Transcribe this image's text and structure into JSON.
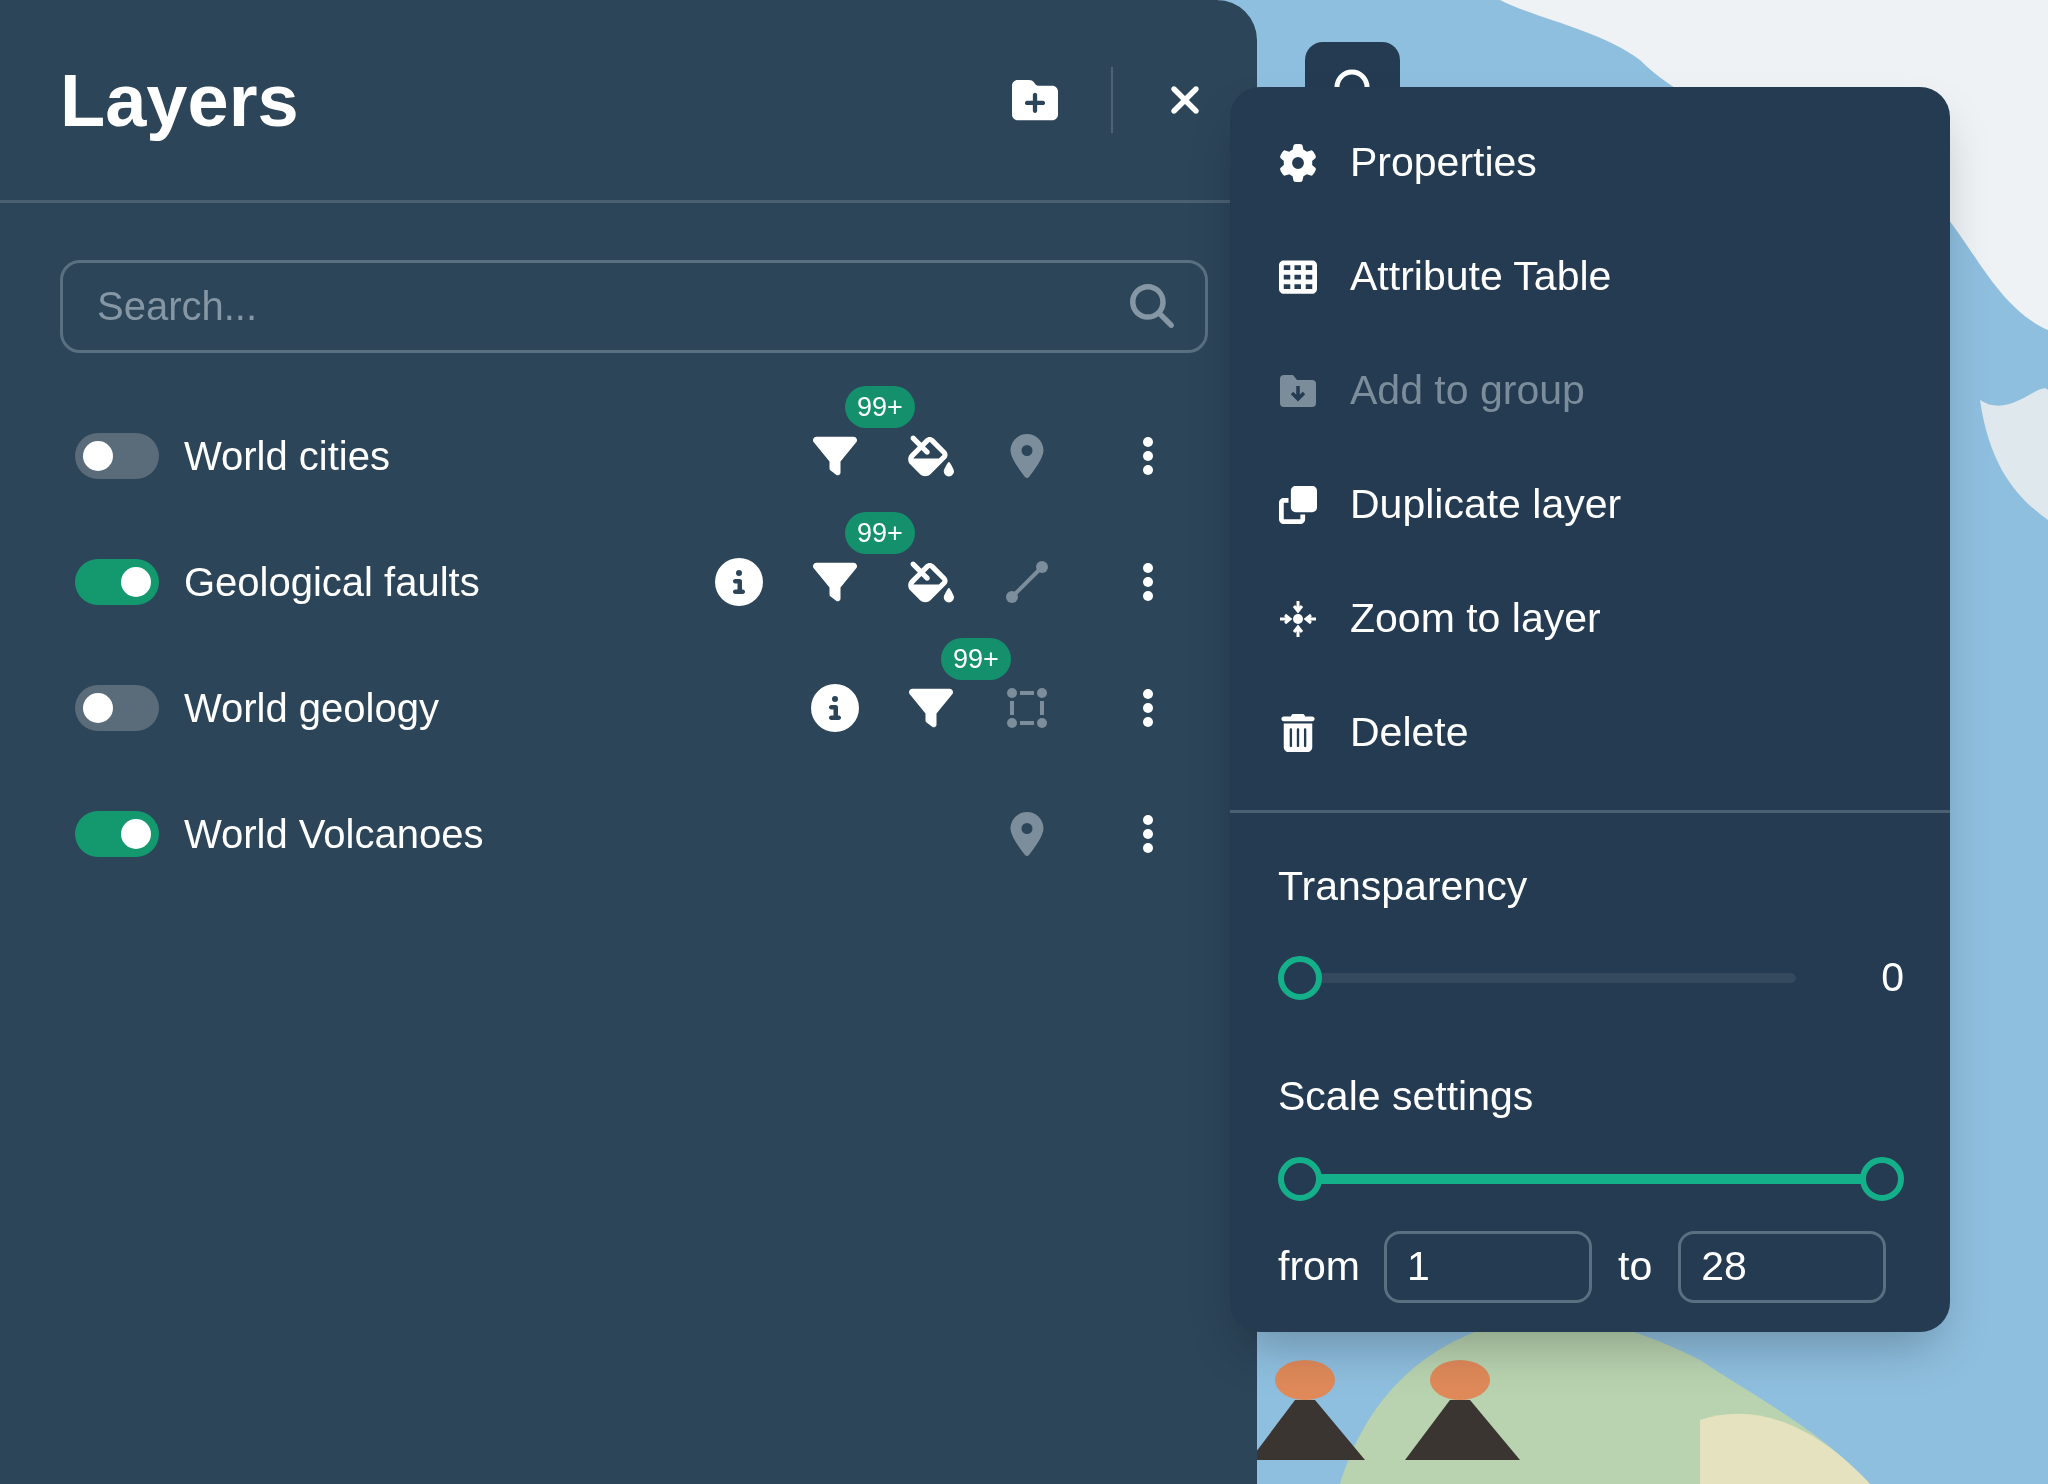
{
  "panel": {
    "title": "Layers",
    "search": {
      "placeholder": "Search..."
    }
  },
  "layers": [
    {
      "name": "World cities",
      "on": false,
      "tools": [
        {
          "kind": "filter",
          "disabled": false,
          "badge": "99+"
        },
        {
          "kind": "style",
          "disabled": false
        },
        {
          "kind": "point",
          "disabled": true
        }
      ]
    },
    {
      "name": "Geological faults",
      "on": true,
      "tools": [
        {
          "kind": "info",
          "disabled": false
        },
        {
          "kind": "filter",
          "disabled": false,
          "badge": "99+"
        },
        {
          "kind": "style",
          "disabled": false
        },
        {
          "kind": "line",
          "disabled": true
        }
      ]
    },
    {
      "name": "World geology",
      "on": false,
      "tools": [
        {
          "kind": "info",
          "disabled": false
        },
        {
          "kind": "filter",
          "disabled": false,
          "badge": "99+"
        },
        {
          "kind": "polygon",
          "disabled": true
        }
      ]
    },
    {
      "name": "World Volcanoes",
      "on": true,
      "tools": [
        {
          "kind": "point",
          "disabled": true
        }
      ]
    }
  ],
  "menu": {
    "items": [
      {
        "kind": "properties",
        "label": "Properties",
        "disabled": false
      },
      {
        "kind": "table",
        "label": "Attribute Table",
        "disabled": false
      },
      {
        "kind": "group",
        "label": "Add to group",
        "disabled": true
      },
      {
        "kind": "duplicate",
        "label": "Duplicate layer",
        "disabled": false
      },
      {
        "kind": "zoom",
        "label": "Zoom to layer",
        "disabled": false
      },
      {
        "kind": "delete",
        "label": "Delete",
        "disabled": false
      }
    ],
    "transparency": {
      "label": "Transparency",
      "level": 0,
      "reading": "0"
    },
    "scale": {
      "label": "Scale settings",
      "level": 1,
      "from_label": "from",
      "from": "1",
      "to_label": "to",
      "to": "28"
    }
  }
}
